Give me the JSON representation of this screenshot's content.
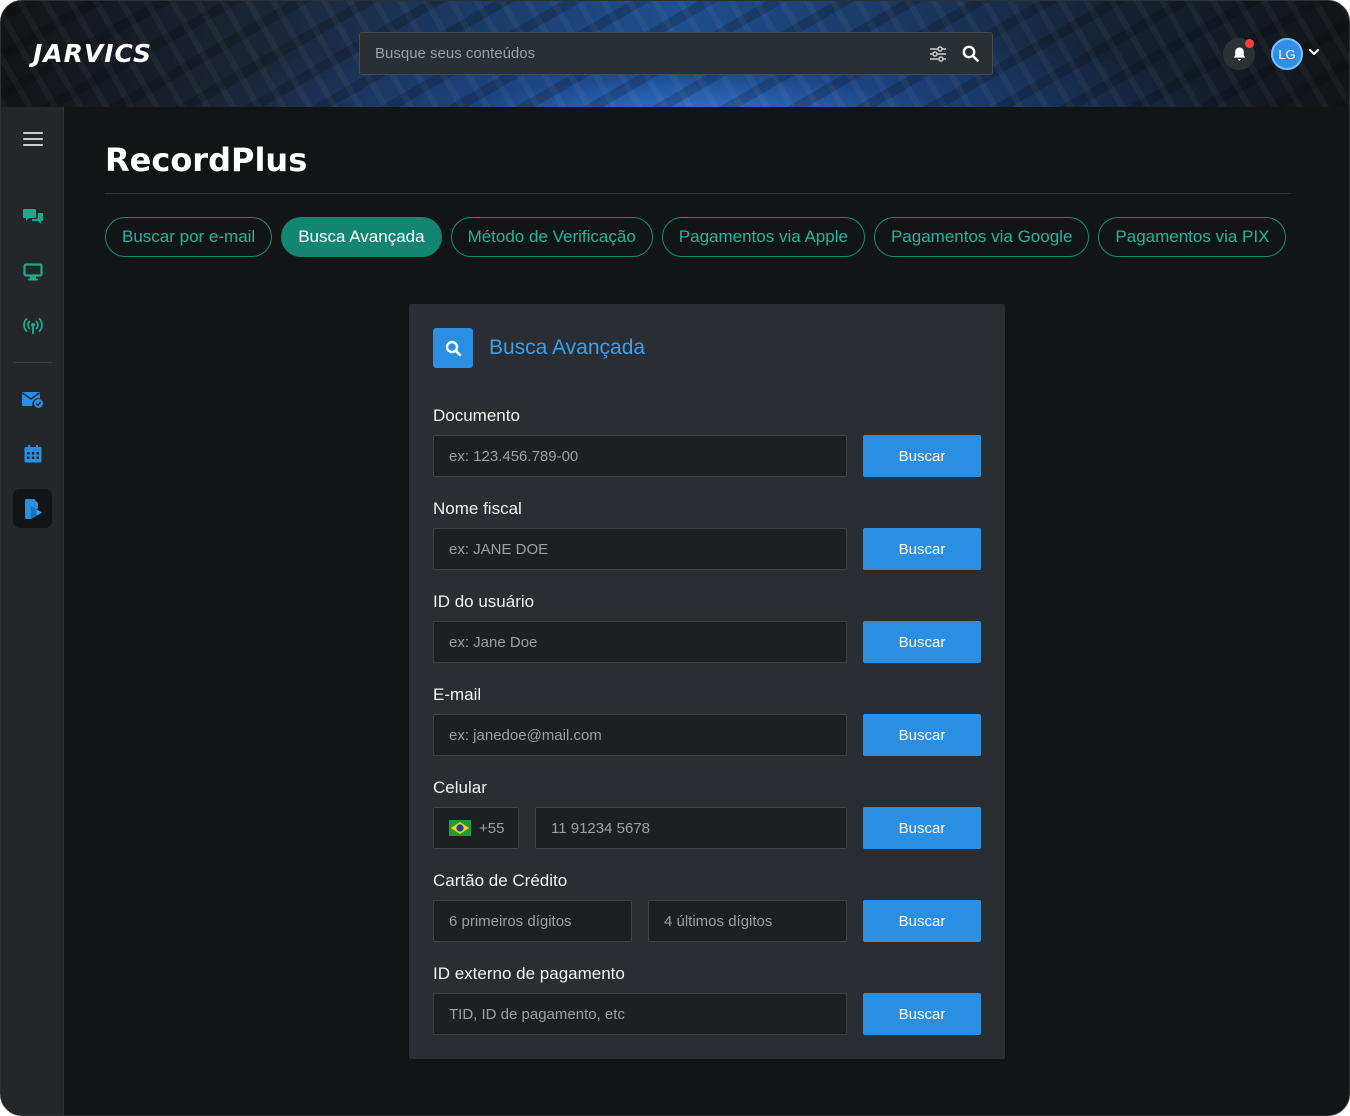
{
  "app": {
    "logo": "JARVICS"
  },
  "header": {
    "search_placeholder": "Busque seus conteúdos",
    "avatar_initials": "LG"
  },
  "page": {
    "title": "RecordPlus"
  },
  "tabs": [
    {
      "label": "Buscar por e-mail",
      "active": false
    },
    {
      "label": "Busca Avançada",
      "active": true
    },
    {
      "label": "Método de Verificação",
      "active": false
    },
    {
      "label": "Pagamentos via Apple",
      "active": false
    },
    {
      "label": "Pagamentos via Google",
      "active": false
    },
    {
      "label": "Pagamentos via PIX",
      "active": false
    }
  ],
  "card": {
    "title": "Busca Avançada",
    "button_label": "Buscar",
    "fields": {
      "documento": {
        "label": "Documento",
        "placeholder": "ex: 123.456.789-00"
      },
      "nome_fiscal": {
        "label": "Nome fiscal",
        "placeholder": "ex: JANE DOE"
      },
      "id_usuario": {
        "label": "ID do usuário",
        "placeholder": "ex: Jane Doe"
      },
      "email": {
        "label": "E-mail",
        "placeholder": "ex: janedoe@mail.com"
      },
      "celular": {
        "label": "Celular",
        "country_code": "+55",
        "placeholder": "11 91234 5678"
      },
      "cartao": {
        "label": "Cartão de Crédito",
        "first_placeholder": "6 primeiros dígitos",
        "last_placeholder": "4 últimos dígitos"
      },
      "id_externo": {
        "label": "ID externo de pagamento",
        "placeholder": "TID, ID de pagamento, etc"
      }
    }
  },
  "sidebar": {
    "items": [
      {
        "icon": "hamburger-menu-icon"
      },
      {
        "icon": "chat-bubbles-icon"
      },
      {
        "icon": "monitor-icon"
      },
      {
        "icon": "broadcast-antenna-icon"
      },
      {
        "icon": "mail-check-icon"
      },
      {
        "icon": "calendar-icon"
      },
      {
        "icon": "play-document-icon",
        "active": true
      }
    ]
  },
  "colors": {
    "accent_blue": "#2a8fe3",
    "accent_teal": "#138571",
    "notification_dot": "#ff3b3b",
    "background": "#121516",
    "card": "#2a2d31"
  }
}
